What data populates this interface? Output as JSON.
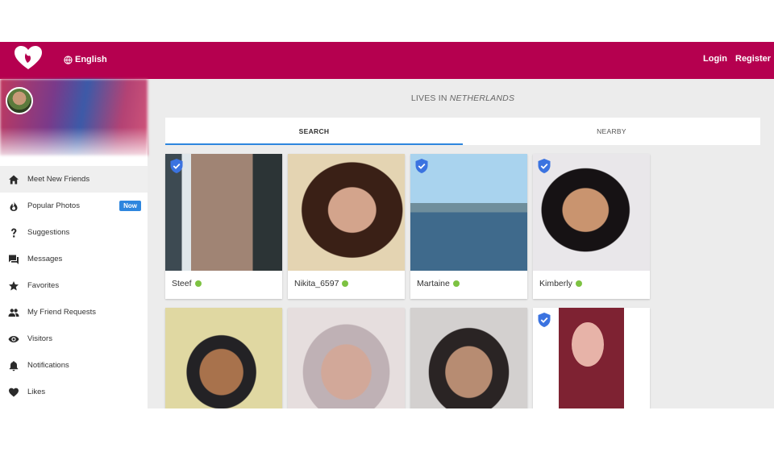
{
  "header": {
    "language": "English",
    "login": "Login",
    "register": "Register"
  },
  "sidebar": {
    "items": [
      {
        "label": "Meet New Friends",
        "icon": "home-icon",
        "active": true
      },
      {
        "label": "Popular Photos",
        "icon": "fire-icon",
        "badge": "Now"
      },
      {
        "label": "Suggestions",
        "icon": "question-icon"
      },
      {
        "label": "Messages",
        "icon": "chat-icon"
      },
      {
        "label": "Favorites",
        "icon": "star-icon"
      },
      {
        "label": "My Friend Requests",
        "icon": "people-icon"
      },
      {
        "label": "Visitors",
        "icon": "eye-icon"
      },
      {
        "label": "Notifications",
        "icon": "bell-icon"
      },
      {
        "label": "Likes",
        "icon": "heart-icon"
      }
    ]
  },
  "main": {
    "lives_prefix": "LIVES IN",
    "lives_country": "NETHERLANDS",
    "tabs": [
      {
        "label": "SEARCH",
        "active": true
      },
      {
        "label": "NEARBY",
        "active": false
      }
    ],
    "profiles": [
      {
        "name": "Steef",
        "online": true,
        "verified": true
      },
      {
        "name": "Nikita_6597",
        "online": true,
        "verified": false
      },
      {
        "name": "Martaine",
        "online": true,
        "verified": true
      },
      {
        "name": "Kimberly",
        "online": true,
        "verified": true
      },
      {
        "name": "",
        "online": false,
        "verified": false
      },
      {
        "name": "",
        "online": false,
        "verified": false
      },
      {
        "name": "",
        "online": false,
        "verified": false
      },
      {
        "name": "",
        "online": false,
        "verified": true
      }
    ]
  },
  "colors": {
    "brand": "#b5004f",
    "accent": "#2e86de",
    "online": "#7dc242",
    "verified": "#3b73e0"
  }
}
